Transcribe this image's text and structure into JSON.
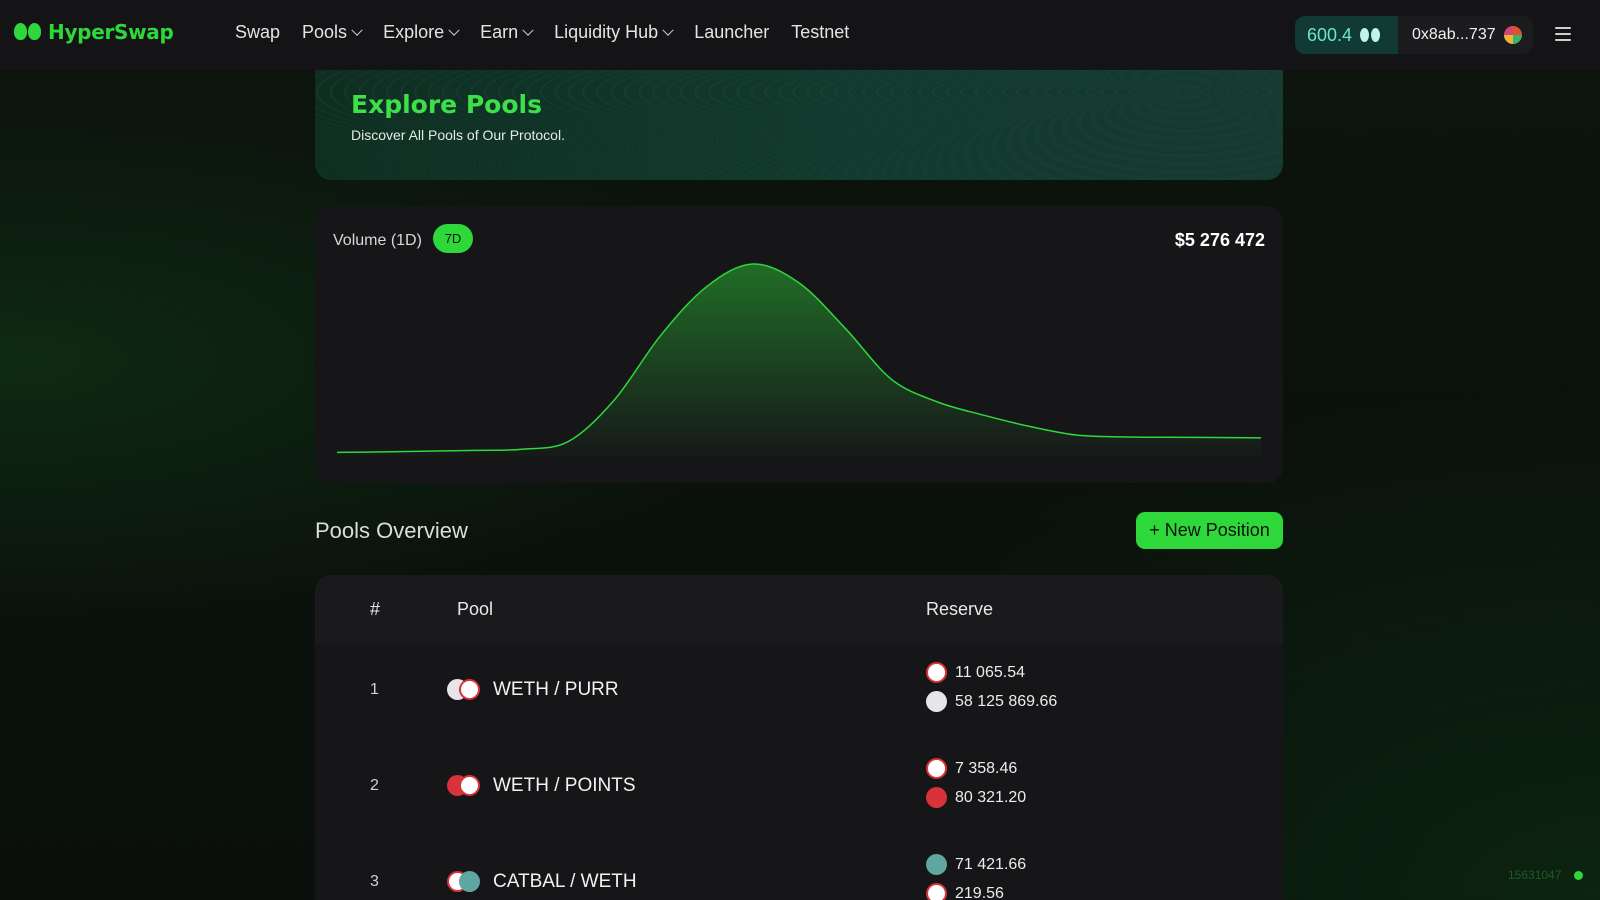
{
  "header": {
    "brand": "HyperSwap",
    "nav": [
      {
        "label": "Swap",
        "dropdown": false
      },
      {
        "label": "Pools",
        "dropdown": true
      },
      {
        "label": "Explore",
        "dropdown": true
      },
      {
        "label": "Earn",
        "dropdown": true
      },
      {
        "label": "Liquidity Hub",
        "dropdown": true
      },
      {
        "label": "Launcher",
        "dropdown": false
      },
      {
        "label": "Testnet",
        "dropdown": false
      }
    ],
    "balance": "600.4",
    "wallet_address": "0x8ab...737"
  },
  "banner": {
    "title": "Explore Pools",
    "subtitle": "Discover All Pools of Our Protocol."
  },
  "volume": {
    "label": "Volume (1D)",
    "range_button": "7D",
    "total": "$5 276 472"
  },
  "chart_data": {
    "type": "area",
    "title": "Volume (1D)",
    "x": [
      0,
      1,
      2,
      3,
      4,
      5,
      6,
      7,
      8,
      9,
      10,
      11,
      12,
      13,
      14,
      15,
      16,
      17,
      18,
      19,
      20
    ],
    "values": [
      0.3,
      0.6,
      1.0,
      1.4,
      2.0,
      6.0,
      28,
      62,
      88,
      100,
      90,
      66,
      39,
      27,
      20,
      14,
      9.5,
      8.5,
      8.3,
      8.2,
      8.0
    ],
    "ylim": [
      0,
      100
    ],
    "grid": false,
    "color": "#2ed83a"
  },
  "pools": {
    "title": "Pools Overview",
    "new_position_label": "+ New Position",
    "columns": [
      "#",
      "Pool",
      "Reserve"
    ],
    "rows": [
      {
        "rank": "1",
        "pair": "WETH / PURR",
        "icons": [
          "purr",
          "weth"
        ],
        "reserves": [
          {
            "token": "weth",
            "amount": "11 065.54"
          },
          {
            "token": "purr",
            "amount": "58 125 869.66"
          }
        ]
      },
      {
        "rank": "2",
        "pair": "WETH / POINTS",
        "icons": [
          "points",
          "weth"
        ],
        "reserves": [
          {
            "token": "weth",
            "amount": "7 358.46"
          },
          {
            "token": "points",
            "amount": "80 321.20"
          }
        ]
      },
      {
        "rank": "3",
        "pair": "CATBAL / WETH",
        "icons": [
          "weth",
          "catbal"
        ],
        "reserves": [
          {
            "token": "catbal",
            "amount": "71 421.66"
          },
          {
            "token": "weth",
            "amount": "219.56"
          }
        ]
      }
    ]
  },
  "footer": {
    "block_number": "15631047",
    "status_color": "#2ed83a"
  }
}
